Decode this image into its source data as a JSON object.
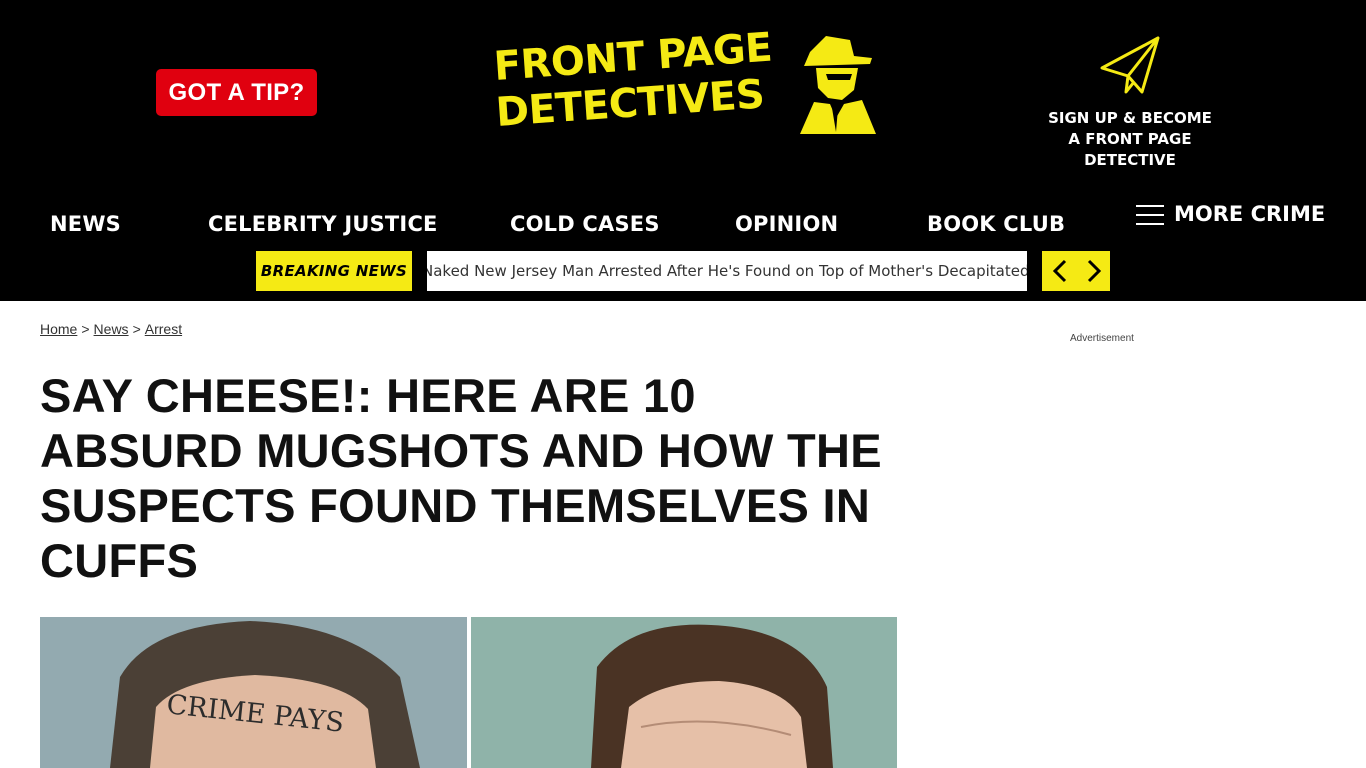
{
  "header": {
    "tip_button": "GOT A TIP?",
    "logo": {
      "line1": "FRONT PAGE",
      "line2": "DETECTIVES"
    },
    "signup": {
      "line1": "SIGN UP & BECOME",
      "line2": "A FRONT PAGE DETECTIVE",
      "icon": "paper-plane-icon"
    }
  },
  "nav": {
    "items": [
      "NEWS",
      "CELEBRITY JUSTICE",
      "COLD CASES",
      "OPINION",
      "BOOK CLUB"
    ],
    "more": "MORE CRIME"
  },
  "breaking": {
    "label": "BREAKING NEWS",
    "headline": "Naked New Jersey Man Arrested After He's Found on Top of Mother's Decapitated Body"
  },
  "breadcrumb": {
    "items": [
      "Home",
      "News",
      "Arrest"
    ],
    "separator": ">"
  },
  "ad_label": "Advertisement",
  "article": {
    "headline": "SAY CHEESE!: HERE ARE 10 ABSURD MUGSHOTS AND HOW THE SUSPECTS FOUND THEMSELVES IN CUFFS",
    "photo_left_text": "CRIME PAYS"
  },
  "colors": {
    "brand_yellow": "#f5ea14",
    "tip_red": "#e0000f",
    "header_bg": "#000000"
  }
}
